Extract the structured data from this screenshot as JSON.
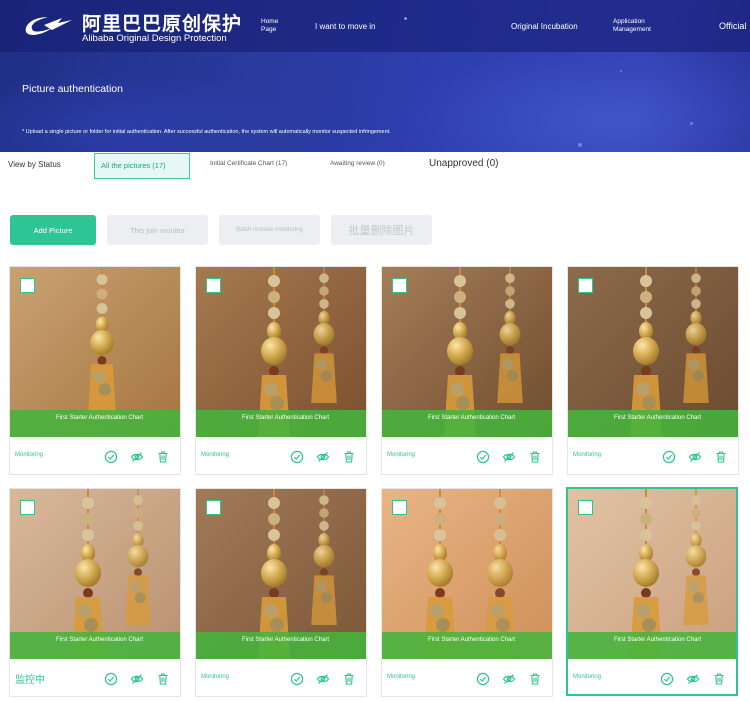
{
  "header": {
    "logo_cn": "阿里巴巴原创保护",
    "logo_en": "Alibaba Original Design Protection",
    "nav": {
      "home": "Home Page",
      "move_in": "I want to move in",
      "star": "*",
      "incubation": "Original Incubation",
      "app_management": "Application Management",
      "official": "Official"
    }
  },
  "banner": {
    "title": "Picture authentication",
    "description": "* Upload a single picture or folder for initial authentication. After successful authentication, the system will automatically monitor suspected infringement."
  },
  "tabs": {
    "view_by": "View by Status",
    "all": "All the pictures (17)",
    "initial": "Initial Certificate Chart (17)",
    "awaiting": "Awaiting review (0)",
    "unapproved": "Unapproved (0)"
  },
  "buttons": {
    "add": "Add Picture",
    "join": "This join monitor",
    "batch_remove": "Batch remove monitoring",
    "batch_delete": "批量删除图片"
  },
  "cards": [
    {
      "ribbon": "First Starter Authentication Chart",
      "status": "Monitoring"
    },
    {
      "ribbon": "First Starter Authentication Chart",
      "status": "Monitoring"
    },
    {
      "ribbon": "First Starter Authentication Chart",
      "status": "Monitoring"
    },
    {
      "ribbon": "First Starter Authentication Chart",
      "status": "Monitoring"
    },
    {
      "ribbon": "First Starter Authentication Chart",
      "status": "监控中"
    },
    {
      "ribbon": "First Starter Authentication Chart",
      "status": "Monitoring"
    },
    {
      "ribbon": "First Starter Authentication Chart",
      "status": "Monitoring"
    },
    {
      "ribbon": "First Starter Authentication Chart",
      "status": "Monitoring"
    }
  ],
  "colors": {
    "accent": "#2ec493",
    "banner": "#2a3a9e",
    "ribbon": "#46b43c"
  },
  "icons": [
    "certificate-icon",
    "eye-icon",
    "trash-icon",
    "checkbox-icon"
  ]
}
